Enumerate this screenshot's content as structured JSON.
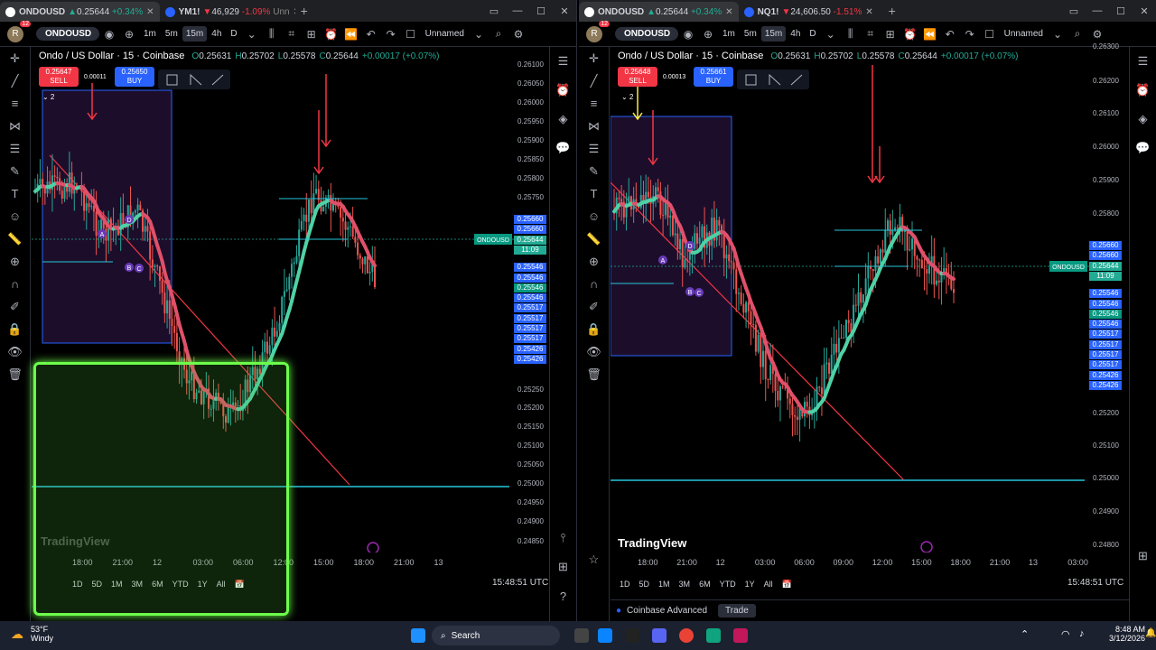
{
  "left": {
    "tabs": [
      {
        "symbol": "ONDOUSD",
        "price": "0.25644",
        "change": "+0.34%",
        "direction": "up",
        "active": true
      },
      {
        "symbol": "YM1!",
        "price": "46,929",
        "change": "-1.09%",
        "suffix": "Unn",
        "direction": "down",
        "active": false
      }
    ],
    "symbol": "ONDOUSD",
    "intervals": [
      "1m",
      "5m",
      "15m",
      "4h",
      "D"
    ],
    "selected_interval": "15m",
    "layout_name": "Unnamed",
    "notification_count": "12",
    "avatar_letter": "R",
    "legend": {
      "name": "Ondo / US Dollar · 15 · Coinbase",
      "open": "0.25631",
      "high": "0.25702",
      "low": "0.25578",
      "close": "0.25644",
      "change": "+0.00017 (+0.07%)"
    },
    "sell": {
      "price": "0.25647",
      "label": "SELL"
    },
    "buy": {
      "price": "0.25650",
      "label": "BUY"
    },
    "spread": "0.00011",
    "price_ticks": [
      "0.26100",
      "0.26050",
      "0.26000",
      "0.25950",
      "0.25900",
      "0.25850",
      "0.25800",
      "0.25750",
      "0.25250",
      "0.25200",
      "0.25150",
      "0.25100",
      "0.25050",
      "0.25000",
      "0.24950",
      "0.24900",
      "0.24850"
    ],
    "price_tags": [
      "0.25660",
      "0.25660",
      "0.25644",
      "11:09",
      "0.25546",
      "0.25546",
      "0.25546",
      "0.25546",
      "0.25517",
      "0.25517",
      "0.25517",
      "0.25517",
      "0.25426",
      "0.25426"
    ],
    "symbol_tag": "ONDOUSD",
    "time_ticks": [
      "18:00",
      "21:00",
      "12",
      "03:00",
      "06:00",
      "12:00",
      "15:00",
      "18:00",
      "21:00",
      "13"
    ],
    "ranges": [
      "1D",
      "5D",
      "1M",
      "3M",
      "6M",
      "YTD",
      "1Y",
      "All"
    ],
    "clock": "15:48:51 UTC",
    "watermark": "TradingView",
    "pattern_labels": [
      "A",
      "B",
      "C",
      "D"
    ],
    "box_label": "2"
  },
  "right": {
    "tabs": [
      {
        "symbol": "ONDOUSD",
        "price": "0.25644",
        "change": "+0.34%",
        "direction": "up",
        "active": true
      },
      {
        "symbol": "NQ1!",
        "price": "24,606.50",
        "change": "-1.51%",
        "suffix": "%",
        "direction": "down",
        "active": false
      }
    ],
    "symbol": "ONDOUSD",
    "intervals": [
      "1m",
      "5m",
      "15m",
      "4h",
      "D"
    ],
    "selected_interval": "15m",
    "layout_name": "Unnamed",
    "notification_count": "12",
    "avatar_letter": "R",
    "legend": {
      "name": "Ondo / US Dollar · 15 · Coinbase",
      "open": "0.25631",
      "high": "0.25702",
      "low": "0.25578",
      "close": "0.25644",
      "change": "+0.00017 (+0.07%)"
    },
    "sell": {
      "price": "0.25648",
      "label": "SELL"
    },
    "buy": {
      "price": "0.25661",
      "label": "BUY"
    },
    "spread": "0.00013",
    "price_ticks": [
      "0.26300",
      "0.26200",
      "0.26100",
      "0.26000",
      "0.25900",
      "0.25800",
      "0.25200",
      "0.25100",
      "0.25000",
      "0.24900",
      "0.24800"
    ],
    "price_tags": [
      "0.25660",
      "0.25660",
      "0.25644",
      "11:09",
      "0.25546",
      "0.25546",
      "0.25546",
      "0.25546",
      "0.25517",
      "0.25517",
      "0.25517",
      "0.25517",
      "0.25426",
      "0.25426"
    ],
    "symbol_tag": "ONDOUSD",
    "time_ticks": [
      "18:00",
      "21:00",
      "12",
      "03:00",
      "06:00",
      "09:00",
      "12:00",
      "15:00",
      "18:00",
      "21:00",
      "13",
      "03:00"
    ],
    "ranges": [
      "1D",
      "5D",
      "1M",
      "3M",
      "6M",
      "YTD",
      "1Y",
      "All"
    ],
    "clock": "15:48:51 UTC",
    "watermark": "TradingView",
    "broker": "Coinbase Advanced",
    "trade_label": "Trade",
    "pattern_labels": [
      "A",
      "B",
      "C",
      "D"
    ],
    "box_label": "2"
  },
  "taskbar": {
    "temp": "53°F",
    "weather": "Windy",
    "search_placeholder": "Search",
    "time": "8:48 AM",
    "date": "3/12/2026"
  },
  "colors": {
    "up": "#26a69a",
    "down": "#ef5350",
    "accent": "#2962ff",
    "highlight": "#6cff4a"
  }
}
